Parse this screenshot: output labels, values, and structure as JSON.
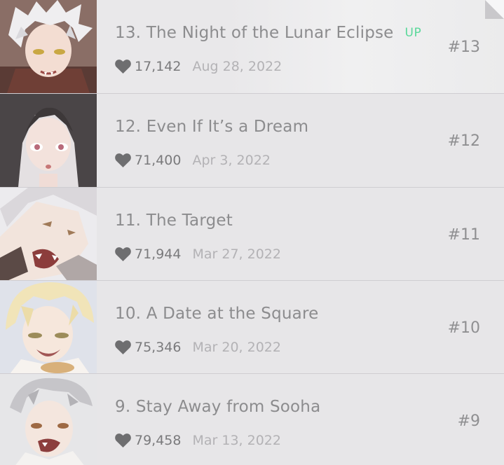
{
  "episodes": [
    {
      "title": "13. The Night of the Lunar Eclipse",
      "badge": "UP",
      "likes": "17,142",
      "date": "Aug 28, 2022",
      "number": "#13",
      "thumbnail": "character-portrait-white-hair"
    },
    {
      "title": "12. Even If It’s a Dream",
      "badge": "",
      "likes": "71,400",
      "date": "Apr 3, 2022",
      "number": "#12",
      "thumbnail": "character-portrait-dark-hair"
    },
    {
      "title": "11. The Target",
      "badge": "",
      "likes": "71,944",
      "date": "Mar 27, 2022",
      "number": "#11",
      "thumbnail": "character-portrait-shouting"
    },
    {
      "title": "10. A Date at the Square",
      "badge": "",
      "likes": "75,346",
      "date": "Mar 20, 2022",
      "number": "#10",
      "thumbnail": "character-portrait-blonde"
    },
    {
      "title": "9. Stay Away from Sooha",
      "badge": "",
      "likes": "79,458",
      "date": "Mar 13, 2022",
      "number": "#9",
      "thumbnail": "character-portrait-grey-hair"
    }
  ],
  "colors": {
    "up_badge": "#5ad89a",
    "title": "#8c8c8e",
    "date": "#b3b2b5",
    "row_background": "#e7e6e8"
  },
  "icons": {
    "likes": "heart-icon",
    "corner": "page-curl-icon"
  }
}
